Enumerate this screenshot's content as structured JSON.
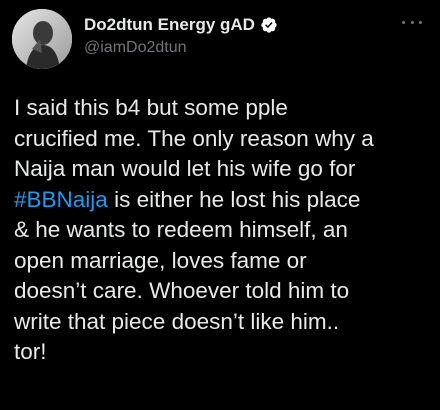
{
  "author": {
    "display_name": "Do2dtun Energy gAD",
    "handle": "@iamDo2dtun",
    "verified_icon": "verified-badge-icon",
    "avatar": "profile-photo"
  },
  "menu": {
    "more_icon": "more-options-icon"
  },
  "tweet": {
    "line_1": "I said this b4 but some pple",
    "line_2": "crucified me. The only reason why a",
    "line_3": "Naija man would let his wife go for",
    "line_4_hashtag": "#BBNaija",
    "line_4_rest": " is either he lost his place",
    "line_5": "& he wants to redeem himself, an",
    "line_6": "open marriage, loves fame or",
    "line_7": "doesn’t care. Whoever told him to",
    "line_8": "write that piece doesn’t like him..",
    "line_9": "tor!"
  },
  "colors": {
    "background": "#000000",
    "text": "#e7e9ea",
    "secondary": "#71767b",
    "accent": "#1d9bf0"
  }
}
